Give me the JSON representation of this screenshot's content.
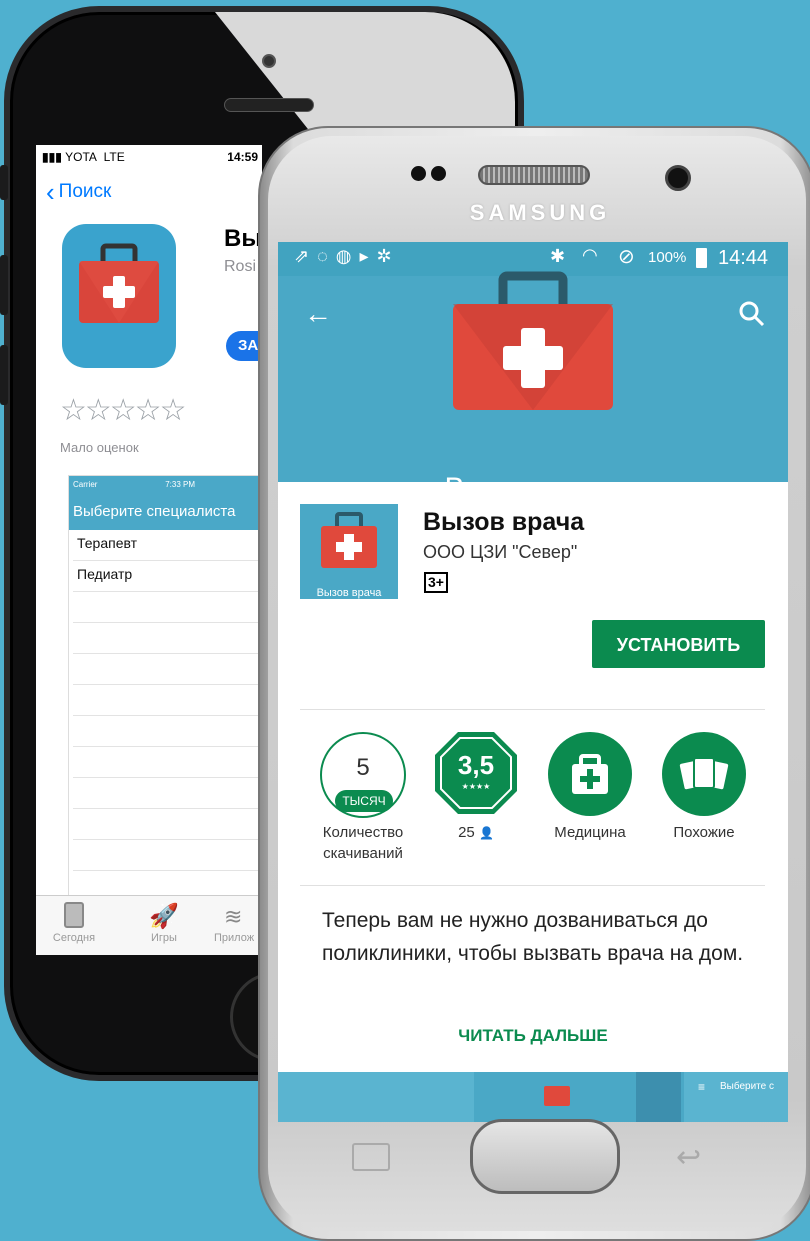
{
  "ios": {
    "status": {
      "carrier": "YOTA",
      "network": "LTE",
      "time": "14:59"
    },
    "back_label": "Поиск",
    "app_name_partial": "Вы",
    "developer_partial": "Rosi",
    "get_button_partial": "ЗА",
    "rating_label": "Мало оценок",
    "screenshot": {
      "carrier": "Carrier",
      "time": "7:33 PM",
      "title": "Выберите специалиста",
      "rows": [
        "Терапевт",
        "Педиатр"
      ]
    },
    "tabs": [
      "Сегодня",
      "Игры",
      "Прилож"
    ]
  },
  "android": {
    "brand": "SAMSUNG",
    "status": {
      "battery": "100%",
      "time": "14:44"
    },
    "header_title": "Вызов врача",
    "app_name": "Вызов врача",
    "developer": "ООО ЦЗИ \"Север\"",
    "age_rating": "3+",
    "icon_caption": "Вызов врача",
    "install_label": "УСТАНОВИТЬ",
    "stats": {
      "downloads_number": "5",
      "downloads_unit": "ТЫСЯЧ",
      "downloads_label": "Количество скачиваний",
      "rating_value": "3,5",
      "rating_count": "25",
      "category_label": "Медицина",
      "similar_label": "Похожие"
    },
    "description": "Теперь вам не нужно дозваниваться до поликлиники, чтобы вызвать врача на дом.",
    "read_more_label": "ЧИТАТЬ ДАЛЬШЕ",
    "gallery_snippet": "Выберите с"
  }
}
